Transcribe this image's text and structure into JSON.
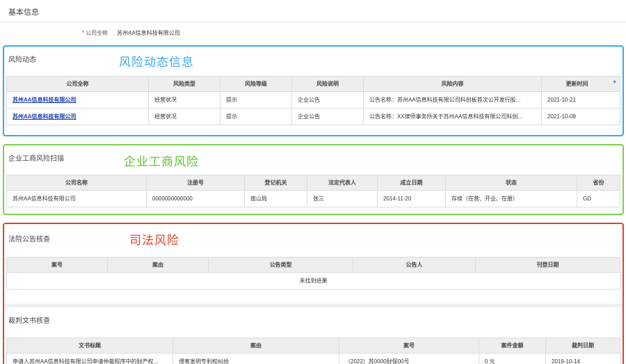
{
  "header": {
    "title": "基本信息",
    "company_label": "公司全称",
    "company_value": "苏州AA信息科技有限公司"
  },
  "annotations": {
    "risk_dynamic": "风险动态信息",
    "business": "企业工商风险",
    "judicial": "司法风险"
  },
  "risk_dynamic": {
    "title": "风险动态",
    "columns": [
      "公司全称",
      "风险类型",
      "风险等级",
      "风险说明",
      "风险内容",
      "更新时间"
    ],
    "rows": [
      [
        "苏州AA信息科技有限公司",
        "经营状况",
        "提示",
        "企业公告",
        "公告名称：苏州AA信息科技有限公司科创板首次公开发行股...",
        "2021-10-21"
      ],
      [
        "苏州AA信息科技有限公司",
        "经营状况",
        "提示",
        "企业公告",
        "公告名称：XX律师事务所关于苏州AA信息科技有限公司科创...",
        "2021-10-08"
      ]
    ]
  },
  "business_scan": {
    "title": "企业工商风险扫描",
    "columns": [
      "公司名称",
      "注册号",
      "登记机关",
      "法定代表人",
      "成立日期",
      "状态",
      "省份"
    ],
    "rows": [
      [
        "苏州AA信息科技有限公司",
        "0000000000000",
        "南山局",
        "张三",
        "2014-11-20",
        "存续（在营、开业、在册）",
        "GD"
      ]
    ]
  },
  "court_notice": {
    "title": "法院公告核查",
    "columns": [
      "案号",
      "案由",
      "公告类型",
      "公告人",
      "刊登日期"
    ],
    "empty_text": "未找到结果"
  },
  "judgment": {
    "title": "裁判文书核查",
    "columns": [
      "文书标题",
      "案由",
      "案号",
      "案件金额",
      "裁判日期"
    ],
    "rows": [
      [
        "申请人苏州AA信息科技有限公司申请仲裁程序中的财产权...",
        "侵害发明专利权纠纷",
        "（2022）苏0000财保00号",
        "0 元",
        "2019-10-14"
      ]
    ]
  }
}
